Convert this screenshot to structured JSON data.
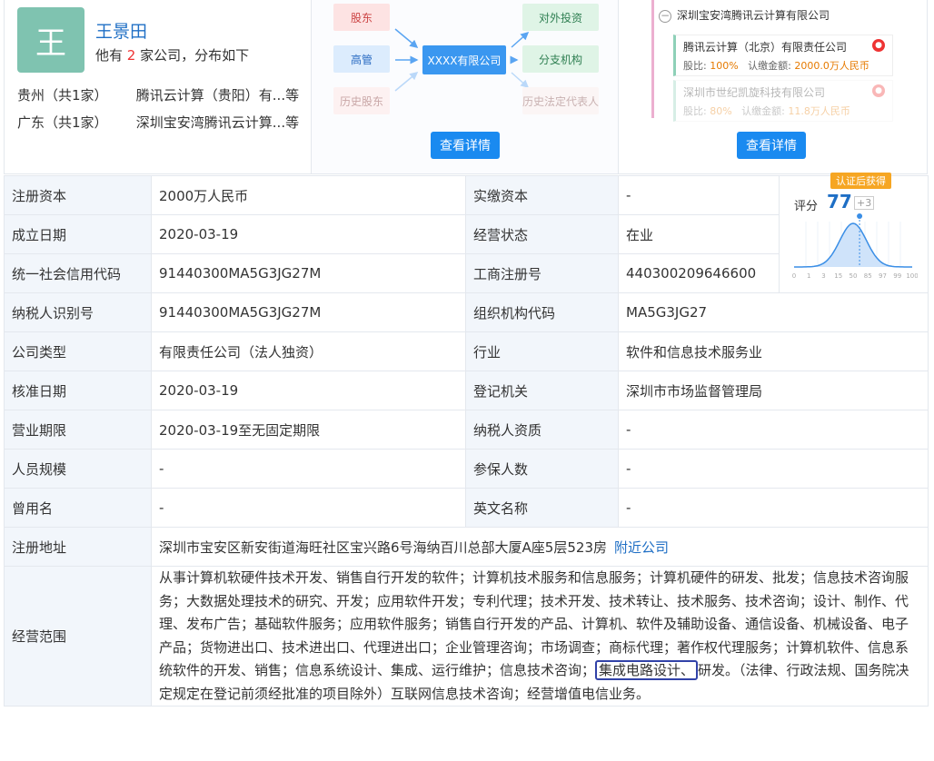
{
  "person": {
    "avatar_char": "王",
    "name": "王景田",
    "desc_prefix": "他有",
    "company_count": "2",
    "desc_suffix": "家公司，分布如下",
    "regions": [
      {
        "name": "贵州（共1家）",
        "company": "腾讯云计算（贵阳）有...等"
      },
      {
        "name": "广东（共1家）",
        "company": "深圳宝安湾腾讯云计算...等"
      }
    ]
  },
  "diagram": {
    "left": [
      "股东",
      "高管",
      "历史股东"
    ],
    "center": "XXXX有限公司",
    "right": [
      "对外投资",
      "分支机构",
      "历史法定代表人"
    ],
    "button": "查看详情"
  },
  "tree": {
    "root": "深圳宝安湾腾讯云计算有限公司",
    "children": [
      {
        "name": "腾讯云计算（北京）有限责任公司",
        "ratio_label": "股比:",
        "ratio": "100%",
        "amount_label": "认缴金额:",
        "amount": "2000.0万人民币"
      },
      {
        "name": "深圳市世纪凯旋科技有限公司",
        "ratio_label": "股比:",
        "ratio": "80%",
        "amount_label": "认缴金额:",
        "amount": "11.8万人民币"
      }
    ],
    "button": "查看详情"
  },
  "score": {
    "tag": "认证后获得",
    "label": "评分",
    "value": "77",
    "plus": "+3",
    "ticks": [
      "0",
      "1",
      "3",
      "15",
      "50",
      "85",
      "97",
      "99",
      "100"
    ],
    "level": 0.77
  },
  "rows": [
    {
      "l1": "注册资本",
      "v1": "2000万人民币",
      "l2": "实缴资本",
      "v2": "-"
    },
    {
      "l1": "成立日期",
      "v1": "2020-03-19",
      "l2": "经营状态",
      "v2": "在业"
    },
    {
      "l1": "统一社会信用代码",
      "v1": "91440300MA5G3JG27M",
      "l2": "工商注册号",
      "v2": "440300209646600"
    },
    {
      "l1": "纳税人识别号",
      "v1": "91440300MA5G3JG27M",
      "l2": "组织机构代码",
      "v2": "MA5G3JG27"
    },
    {
      "l1": "公司类型",
      "v1": "有限责任公司（法人独资）",
      "l2": "行业",
      "v2": "软件和信息技术服务业"
    },
    {
      "l1": "核准日期",
      "v1": "2020-03-19",
      "l2": "登记机关",
      "v2": "深圳市市场监督管理局"
    },
    {
      "l1": "营业期限",
      "v1": "2020-03-19至无固定期限",
      "l2": "纳税人资质",
      "v2": "-"
    },
    {
      "l1": "人员规模",
      "v1": "-",
      "l2": "参保人数",
      "v2": "-"
    },
    {
      "l1": "曾用名",
      "v1": "-",
      "l2": "英文名称",
      "v2": "-"
    }
  ],
  "address": {
    "label": "注册地址",
    "value": "深圳市宝安区新安街道海旺社区宝兴路6号海纳百川总部大厦A座5层523房",
    "link": "附近公司"
  },
  "scope": {
    "label": "经营范围",
    "before": "从事计算机软硬件技术开发、销售自行开发的软件；计算机技术服务和信息服务；计算机硬件的研发、批发；信息技术咨询服务；大数据处理技术的研究、开发；应用软件开发；专利代理；技术开发、技术转让、技术服务、技术咨询；设计、制作、代理、发布广告；基础软件服务；应用软件服务；销售自行开发的产品、计算机、软件及辅助设备、通信设备、机械设备、电子产品；货物进出口、技术进出口、代理进出口；企业管理咨询；市场调查；商标代理；著作权代理服务；计算机软件、信息系统软件的开发、销售；信息系统设计、集成、运行维护；信息技术咨询；",
    "highlight": "集成电路设计、",
    "after": "研发。（法律、行政法规、国务院决定规定在登记前须经批准的项目除外）互联网信息技术咨询；经营增值电信业务。"
  }
}
